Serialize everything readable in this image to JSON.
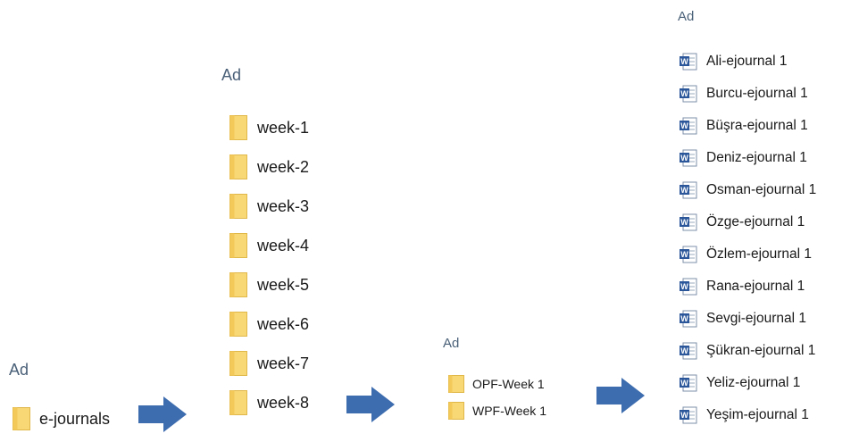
{
  "panel1": {
    "header": "Ad",
    "items": [
      {
        "label": "e-journals",
        "icon": "folder-icon"
      }
    ]
  },
  "panel2": {
    "header": "Ad",
    "items": [
      {
        "label": "week-1",
        "icon": "folder-icon"
      },
      {
        "label": "week-2",
        "icon": "folder-icon"
      },
      {
        "label": "week-3",
        "icon": "folder-icon"
      },
      {
        "label": "week-4",
        "icon": "folder-icon"
      },
      {
        "label": "week-5",
        "icon": "folder-icon"
      },
      {
        "label": "week-6",
        "icon": "folder-icon"
      },
      {
        "label": "week-7",
        "icon": "folder-icon"
      },
      {
        "label": "week-8",
        "icon": "folder-icon"
      }
    ]
  },
  "panel3": {
    "header": "Ad",
    "items": [
      {
        "label": "OPF-Week 1",
        "icon": "folder-icon"
      },
      {
        "label": "WPF-Week 1",
        "icon": "folder-icon"
      }
    ]
  },
  "panel4": {
    "header": "Ad",
    "items": [
      {
        "label": "Ali-ejournal 1",
        "icon": "word-document-icon"
      },
      {
        "label": "Burcu-ejournal 1",
        "icon": "word-document-icon"
      },
      {
        "label": "Büşra-ejournal 1",
        "icon": "word-document-icon"
      },
      {
        "label": "Deniz-ejournal 1",
        "icon": "word-document-icon"
      },
      {
        "label": "Osman-ejournal 1",
        "icon": "word-document-icon"
      },
      {
        "label": "Özge-ejournal 1",
        "icon": "word-document-icon"
      },
      {
        "label": "Özlem-ejournal 1",
        "icon": "word-document-icon"
      },
      {
        "label": "Rana-ejournal 1",
        "icon": "word-document-icon"
      },
      {
        "label": "Sevgi-ejournal 1",
        "icon": "word-document-icon"
      },
      {
        "label": "Şükran-ejournal 1",
        "icon": "word-document-icon"
      },
      {
        "label": "Yeliz-ejournal 1",
        "icon": "word-document-icon"
      },
      {
        "label": "Yeşim-ejournal 1",
        "icon": "word-document-icon"
      }
    ]
  },
  "colors": {
    "folder_fill": "#F8D775",
    "folder_edge": "#E0B84A",
    "arrow_fill": "#3E6DAF",
    "header_text": "#4A6078",
    "word_blue": "#2B579A"
  }
}
